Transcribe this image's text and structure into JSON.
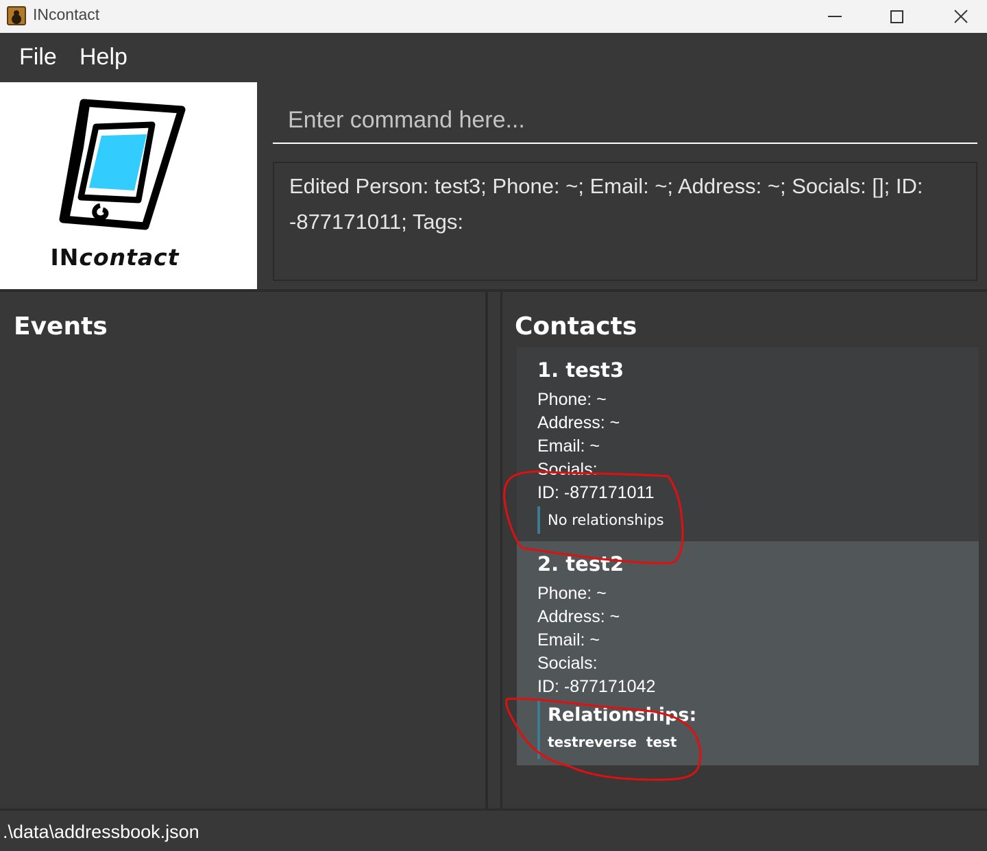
{
  "window": {
    "title": "INcontact",
    "icon": "addressbook-app-icon"
  },
  "menubar": {
    "items": [
      "File",
      "Help"
    ]
  },
  "logo": {
    "text_bold": "IN",
    "text_italic": "contact"
  },
  "command": {
    "placeholder": "Enter command here...",
    "value": ""
  },
  "result": {
    "text": "Edited Person: test3; Phone: ~; Email: ~; Address: ~; Socials: []; ID: -877171011; Tags:"
  },
  "events": {
    "title": "Events"
  },
  "contacts": {
    "title": "Contacts",
    "items": [
      {
        "name": "1. test3",
        "phone": "Phone: ~",
        "address": "Address: ~",
        "email": "Email: ~",
        "socials": "Socials:",
        "id": "ID: -877171011",
        "relationships_none": "No relationships"
      },
      {
        "name": "2. test2",
        "phone": "Phone: ~",
        "address": "Address: ~",
        "email": "Email: ~",
        "socials": "Socials:",
        "id": "ID: -877171042",
        "relationships_title": "Relationships:",
        "relationships": "testreverse  test"
      }
    ]
  },
  "status": {
    "path": ".\\data\\addressbook.json"
  },
  "colors": {
    "background": "#383838",
    "card_default": "#3c3e3f",
    "card_selected": "#515658",
    "relationship_accent": "#3e7b91",
    "annotation": "#e01010"
  }
}
